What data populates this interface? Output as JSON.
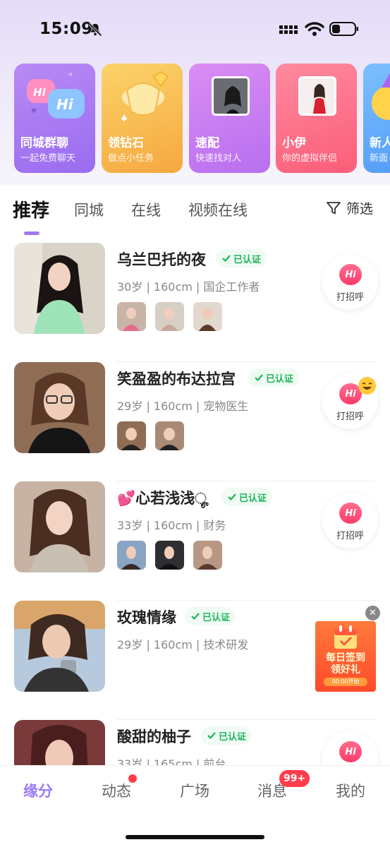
{
  "status_bar": {
    "time": "15:09"
  },
  "feature_cards": [
    {
      "title": "同城群聊",
      "subtitle": "一起免费聊天"
    },
    {
      "title": "领钻石",
      "subtitle": "做点小任务"
    },
    {
      "title": "速配",
      "subtitle": "快速找对人"
    },
    {
      "title": "小伊",
      "subtitle": "你的虚拟伴侣"
    },
    {
      "title": "新人",
      "subtitle": "新面"
    }
  ],
  "tabs": [
    "推荐",
    "同城",
    "在线",
    "视频在线"
  ],
  "filter_label": "筛选",
  "verified_label": "已认证",
  "hi_label": "打招呼",
  "users": [
    {
      "name": "乌兰巴托的夜",
      "meta": "30岁 | 160cm | 国企工作者",
      "verified": true
    },
    {
      "name": "笑盈盈的布达拉宫",
      "meta": "29岁 | 160cm | 宠物医生",
      "verified": true
    },
    {
      "name": "💕心若浅浅ೄ",
      "meta": "33岁 | 160cm | 财务",
      "verified": true
    },
    {
      "name": "玫瑰情缘",
      "meta": "29岁 | 160cm | 技术研发",
      "verified": true
    },
    {
      "name": "酸甜的柚子",
      "meta": "33岁 | 165cm | 前台",
      "verified": true
    }
  ],
  "promo": {
    "title_line1": "每日签到",
    "title_line2": "领好礼",
    "sub": "00:00开始"
  },
  "bottom_nav": [
    "缘分",
    "动态",
    "广场",
    "消息",
    "我的"
  ],
  "messages_badge": "99+",
  "colors": {
    "accent": "#9a7af3",
    "verified": "#1bb55c",
    "hi": "#ff3b6b"
  }
}
